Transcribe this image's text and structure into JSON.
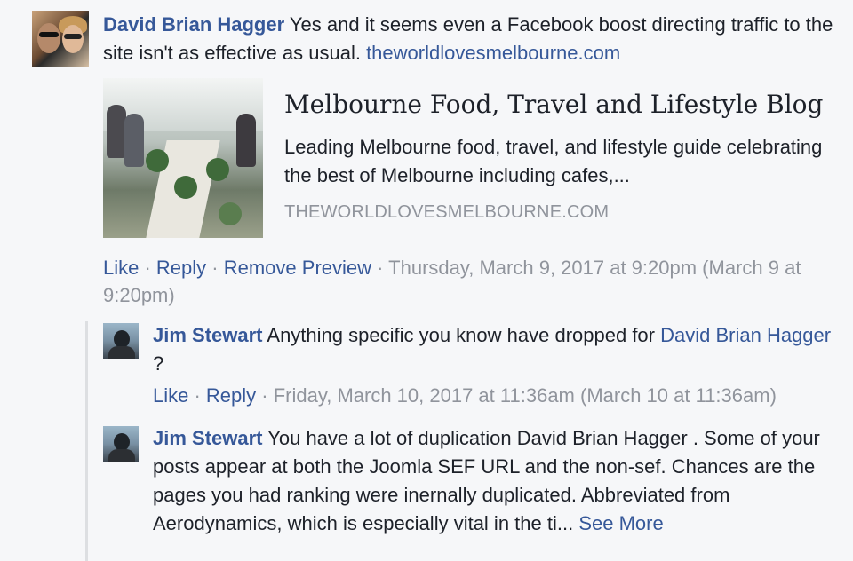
{
  "comment1": {
    "author": "David Brian Hagger",
    "text": " Yes and it seems even a Facebook boost directing traffic to the site isn't as effective as usual. ",
    "link": "theworldlovesmelbourne.com",
    "preview": {
      "title": "Melbourne Food, Travel and Lifestyle Blog",
      "description": "Leading Melbourne food, travel, and lifestyle guide celebrating the best of Melbourne including cafes,...",
      "domain": "THEWORLDLOVESMELBOURNE.COM"
    },
    "actions": {
      "like": "Like",
      "reply": "Reply",
      "remove_preview": "Remove Preview",
      "separator": " · ",
      "timestamp": "Thursday, March 9, 2017 at 9:20pm (March 9 at 9:20pm)"
    }
  },
  "reply1": {
    "author": "Jim Stewart",
    "text": " Anything specific you know have dropped for ",
    "mention": "David Brian Hagger",
    "text_end": " ?",
    "actions": {
      "like": "Like",
      "reply": "Reply",
      "separator": " · ",
      "timestamp": "Friday, March 10, 2017 at 11:36am (March 10 at 11:36am)"
    }
  },
  "reply2": {
    "author": "Jim Stewart",
    "text": " You have a lot of duplication David Brian Hagger . Some of your posts appear at both the Joomla SEF URL and the non-sef. Chances are the pages you had ranking were inernally duplicated. Abbreviated from Aerodynamics, which is especially vital in the ti... ",
    "see_more": "See More"
  },
  "colors": {
    "link": "#365899",
    "meta": "#90949c",
    "text": "#1d2129",
    "background": "#f6f7f9"
  }
}
